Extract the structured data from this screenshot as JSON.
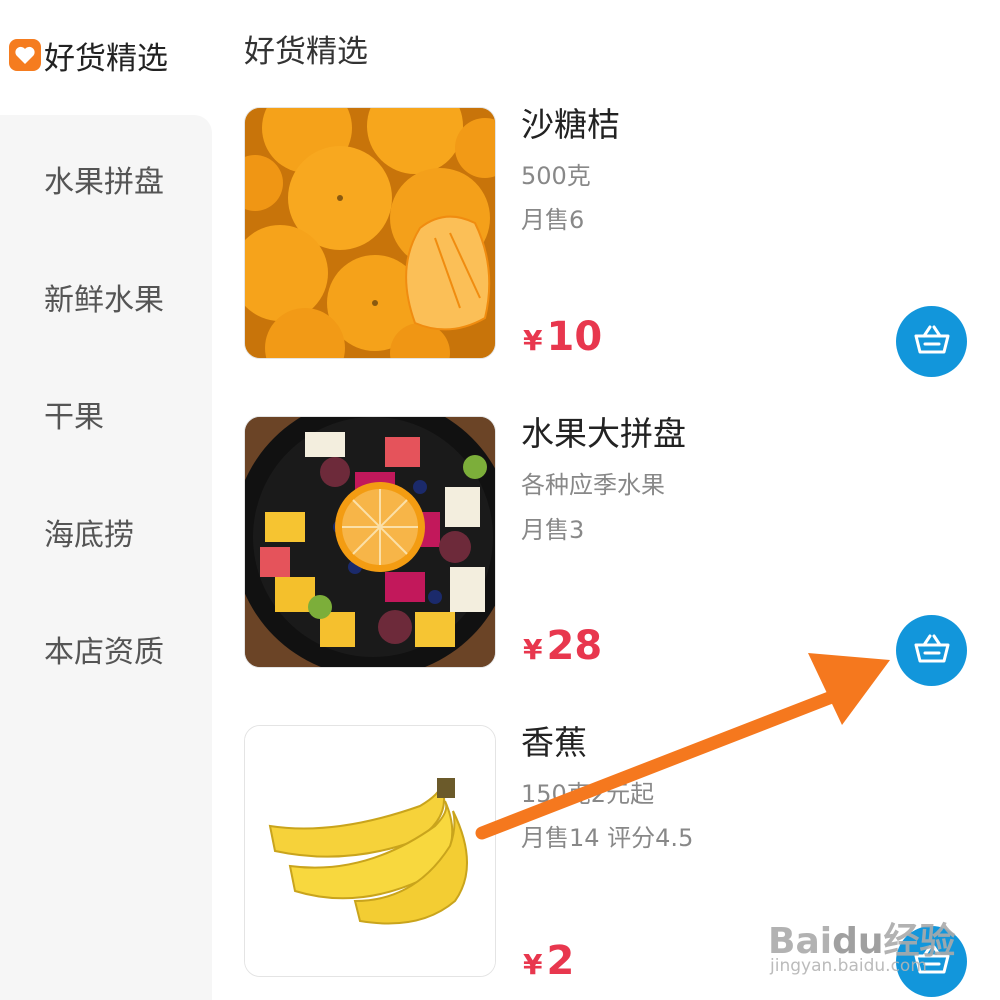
{
  "sidebar": {
    "active": {
      "label": "好货精选",
      "icon": "heart-icon"
    },
    "items": [
      {
        "label": "水果拼盘"
      },
      {
        "label": "新鲜水果"
      },
      {
        "label": "干果"
      },
      {
        "label": "海底捞"
      },
      {
        "label": "本店资质"
      }
    ]
  },
  "main": {
    "section_title": "好货精选",
    "products": [
      {
        "name": "沙糖桔",
        "desc": "500克",
        "sales": "月售6",
        "currency": "¥",
        "price": "10",
        "image": "mandarin-oranges-photo"
      },
      {
        "name": "水果大拼盘",
        "desc": "各种应季水果",
        "sales": "月售3",
        "currency": "¥",
        "price": "28",
        "image": "fruit-platter-photo"
      },
      {
        "name": "香蕉",
        "desc": "150克2元起",
        "sales": "月售14  评分4.5",
        "currency": "¥",
        "price": "2",
        "image": "banana-photo"
      }
    ]
  },
  "overlay": {
    "annotation": "orange-arrow-pointing-to-cart",
    "watermark": "Baidu经验",
    "watermark_url": "jingyan.baidu.com"
  },
  "colors": {
    "accent": "#f57c1f",
    "price": "#e8374e",
    "cart": "#1296db",
    "sidebar_bg": "#f6f6f6"
  }
}
